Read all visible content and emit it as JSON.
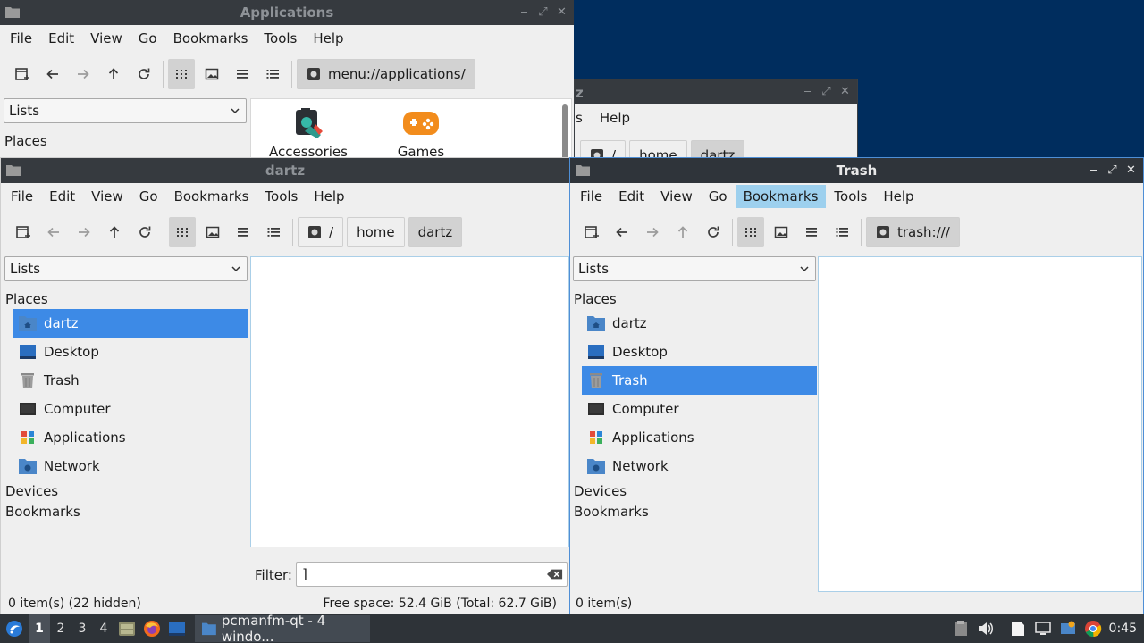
{
  "menus": [
    "File",
    "Edit",
    "View",
    "Go",
    "Bookmarks",
    "Tools",
    "Help"
  ],
  "lists_label": "Lists",
  "sections": {
    "places": "Places",
    "devices": "Devices",
    "bookmarks": "Bookmarks"
  },
  "places": [
    "dartz",
    "Desktop",
    "Trash",
    "Computer",
    "Applications",
    "Network"
  ],
  "win_apps": {
    "title": "Applications",
    "path": "menu://applications/",
    "items": [
      "Accessories",
      "Games"
    ]
  },
  "win_back": {
    "title_fragment": "z",
    "menu_fragment_s": "s",
    "menu_help": "Help",
    "crumbs": [
      "/",
      "home",
      "dartz"
    ]
  },
  "win_dartz": {
    "title": "dartz",
    "crumbs": [
      "/",
      "home",
      "dartz"
    ],
    "filter_label": "Filter:",
    "filter_value": "]",
    "status_left": "0 item(s) (22 hidden)",
    "status_right": "Free space: 52.4 GiB (Total: 62.7 GiB)"
  },
  "win_trash": {
    "title": "Trash",
    "path": "trash:///",
    "status_left": "0 item(s)"
  },
  "taskbar": {
    "workspaces": [
      "1",
      "2",
      "3",
      "4"
    ],
    "task_label": "pcmanfm-qt - 4 windo...",
    "clock": "0:45"
  },
  "colors": {
    "selection": "#3d8ae6",
    "menu_highlight": "#9dd0ee",
    "desktop": "#002d5e",
    "titlebar": "#2f343a"
  }
}
